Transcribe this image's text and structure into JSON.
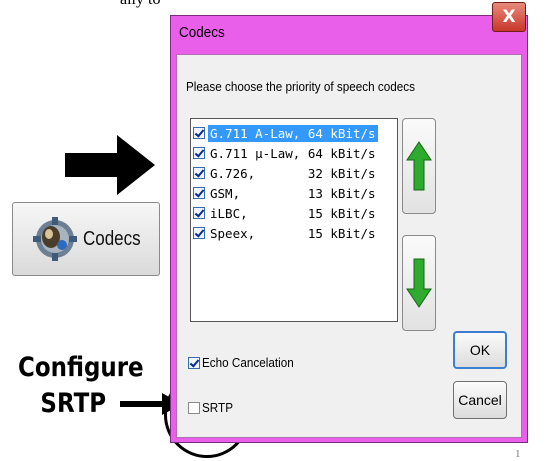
{
  "top_fragment": "ally to",
  "dialog": {
    "title": "Codecs",
    "close_label": "X",
    "prompt": "Please choose the priority of speech codecs",
    "codecs": [
      {
        "label": "G.711 A-Law, 64 kBit/s",
        "checked": true,
        "selected": true
      },
      {
        "label": "G.711 µ-Law, 64 kBit/s",
        "checked": true,
        "selected": false
      },
      {
        "label": "G.726,       32 kBit/s",
        "checked": true,
        "selected": false
      },
      {
        "label": "GSM,         13 kBit/s",
        "checked": true,
        "selected": false
      },
      {
        "label": "iLBC,        15 kBit/s",
        "checked": true,
        "selected": false
      },
      {
        "label": "Speex,       15 kBit/s",
        "checked": true,
        "selected": false
      }
    ],
    "move_up_icon": "green-up-arrow-icon",
    "move_down_icon": "green-down-arrow-icon",
    "ok_label": "OK",
    "cancel_label": "Cancel",
    "echo_cancelation": {
      "label": "Echo Cancelation",
      "checked": true
    },
    "srtp": {
      "label": "SRTP",
      "checked": false
    }
  },
  "launcher": {
    "label": "Codecs",
    "icon": "codec-gear-icon"
  },
  "annotation": {
    "line1": "Configure",
    "line2": "SRTP"
  },
  "page_number": "1",
  "colors": {
    "titlebar": "#ea5fea",
    "selection": "#3399ff",
    "arrow_green": "#2eaa2e",
    "close_red": "#c8372a"
  }
}
